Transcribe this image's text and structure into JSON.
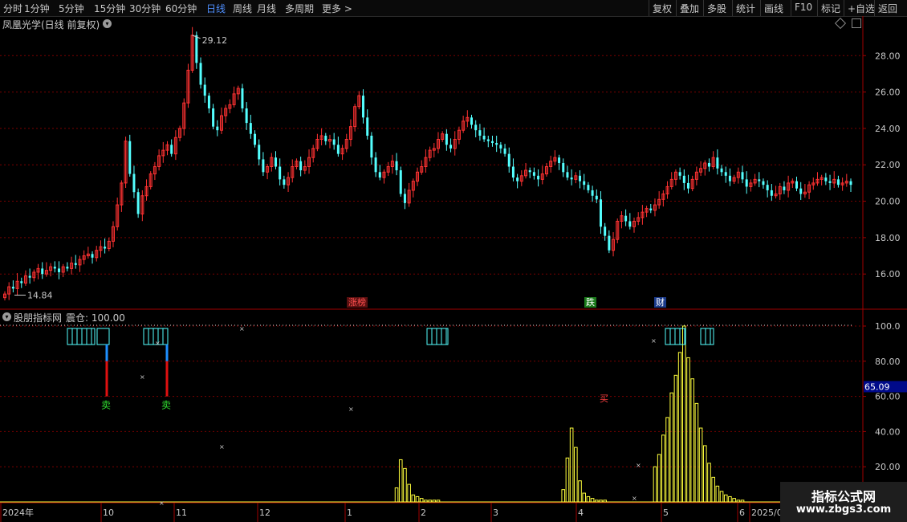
{
  "toolbar": {
    "left": [
      "分时",
      "1分钟",
      "5分钟",
      "15分钟",
      "30分钟",
      "60分钟",
      "日线",
      "周线",
      "月线",
      "多周期",
      "更多 >"
    ],
    "active": "日线",
    "right": [
      "复权",
      "叠加",
      "多股",
      "统计",
      "画线",
      "F10",
      "标记",
      "+自选",
      "返回"
    ]
  },
  "main_panel": {
    "title": "凤凰光学(日线 前复权)",
    "high_label": "29.12",
    "low_label": "14.84",
    "price_axis": [
      "28.00",
      "26.00",
      "24.00",
      "22.00",
      "20.00",
      "18.00",
      "16.00"
    ],
    "events": [
      {
        "label": "涨榜",
        "color": "#ff5050",
        "bg": "#5a1010"
      },
      {
        "label": "跌",
        "color": "#ffffff",
        "bg": "#1a7a1a"
      },
      {
        "label": "财",
        "color": "#ffffff",
        "bg": "#1a3a8a"
      }
    ]
  },
  "indicator_panel": {
    "title": "股朋指标网",
    "value_label": "震仓: 100.00",
    "axis": [
      "100.0",
      "80.00",
      "60.00",
      "40.00",
      "20.00"
    ],
    "current_value": "65.09",
    "signals": [
      "卖",
      "卖",
      "买"
    ]
  },
  "time_axis": [
    "2024年",
    "10",
    "11",
    "12",
    "1",
    "2",
    "3",
    "4",
    "5",
    "6",
    "2025/0"
  ],
  "watermark": {
    "line1": "指标公式网",
    "line2": "www.zbgs3.com"
  },
  "colors": {
    "up": "#ff3232",
    "down": "#54ffff",
    "grid": "#7a0000",
    "axis": "#a00000",
    "indicator": "#ffff3c",
    "box": "#54ffff",
    "accent": "#4f8fff"
  },
  "chart_data": {
    "type": "candlestick",
    "title": "凤凰光学(日线 前复权)",
    "ylim": [
      14.2,
      29.6
    ],
    "yticks": [
      16,
      18,
      20,
      22,
      24,
      26,
      28
    ],
    "x_labels": [
      "2024年",
      "10",
      "11",
      "12",
      "1",
      "2",
      "3",
      "4",
      "5",
      "6",
      "2025/0"
    ],
    "closes": [
      14.9,
      15.3,
      15.2,
      15.6,
      15.5,
      15.9,
      15.8,
      16.1,
      16.3,
      16.0,
      16.2,
      16.4,
      16.3,
      16.1,
      16.4,
      16.3,
      16.6,
      16.5,
      16.8,
      17.0,
      17.1,
      16.9,
      17.3,
      17.5,
      17.4,
      17.8,
      18.6,
      19.8,
      21.0,
      23.3,
      21.5,
      20.5,
      19.3,
      20.3,
      20.8,
      21.5,
      21.9,
      22.5,
      22.8,
      23.1,
      22.6,
      23.5,
      24.0,
      25.4,
      27.2,
      29.12,
      27.6,
      26.4,
      25.8,
      25.1,
      24.1,
      23.9,
      24.7,
      25.1,
      25.3,
      25.9,
      26.2,
      25.1,
      24.3,
      23.7,
      23.1,
      22.3,
      21.6,
      21.9,
      22.4,
      21.9,
      21.2,
      20.9,
      21.3,
      21.9,
      22.2,
      21.7,
      21.9,
      22.4,
      22.9,
      23.4,
      23.6,
      23.3,
      23.4,
      23.1,
      22.6,
      22.9,
      23.4,
      24.1,
      25.2,
      25.8,
      24.6,
      23.6,
      22.4,
      21.6,
      21.3,
      21.6,
      21.9,
      22.2,
      21.7,
      20.4,
      19.9,
      20.6,
      21.1,
      21.6,
      21.9,
      22.4,
      22.8,
      22.9,
      23.4,
      23.7,
      23.1,
      22.9,
      23.4,
      23.9,
      24.4,
      24.6,
      24.2,
      23.9,
      23.6,
      23.4,
      23.3,
      23.2,
      23.1,
      22.9,
      22.6,
      21.9,
      21.3,
      21.1,
      21.4,
      21.7,
      21.6,
      21.4,
      21.2,
      21.5,
      21.9,
      22.2,
      22.4,
      22.1,
      21.6,
      21.3,
      21.2,
      21.4,
      21.1,
      20.9,
      20.6,
      20.3,
      20.1,
      18.6,
      18.1,
      17.3,
      17.9,
      18.9,
      19.2,
      18.9,
      18.6,
      18.9,
      19.1,
      19.4,
      19.6,
      19.5,
      19.8,
      20.1,
      20.4,
      20.8,
      21.2,
      21.6,
      21.4,
      21.0,
      20.7,
      21.2,
      21.6,
      21.8,
      22.1,
      21.9,
      22.4,
      21.8,
      21.6,
      21.4,
      21.1,
      21.3,
      21.6,
      21.2,
      20.8,
      21.0,
      21.2,
      21.1,
      20.9,
      20.6,
      20.3,
      20.4,
      20.8,
      20.6,
      21.0,
      21.1,
      20.7,
      20.4,
      20.5,
      20.9,
      21.0,
      21.2,
      21.3,
      21.1,
      21.0,
      21.2,
      20.9,
      21.0,
      21.1,
      20.9
    ],
    "high_point": 29.12,
    "low_point": 14.84,
    "indicator": {
      "name": "股朋指标网",
      "ylim": [
        0,
        100
      ],
      "yticks": [
        20,
        40,
        60,
        80,
        100
      ],
      "current": 65.09,
      "bars": [
        {
          "start": 94,
          "values": [
            8,
            24,
            19,
            10,
            4,
            3,
            2,
            1,
            1,
            1,
            1
          ]
        },
        {
          "start": 134,
          "values": [
            7,
            25,
            42,
            31,
            12,
            5,
            3,
            2,
            1,
            1,
            1
          ]
        },
        {
          "start": 156,
          "values": [
            20,
            27,
            38,
            48,
            62,
            72,
            85,
            100,
            82,
            70,
            56,
            42,
            32,
            22,
            14,
            9,
            6,
            4,
            3,
            2,
            1,
            1
          ]
        }
      ]
    }
  }
}
